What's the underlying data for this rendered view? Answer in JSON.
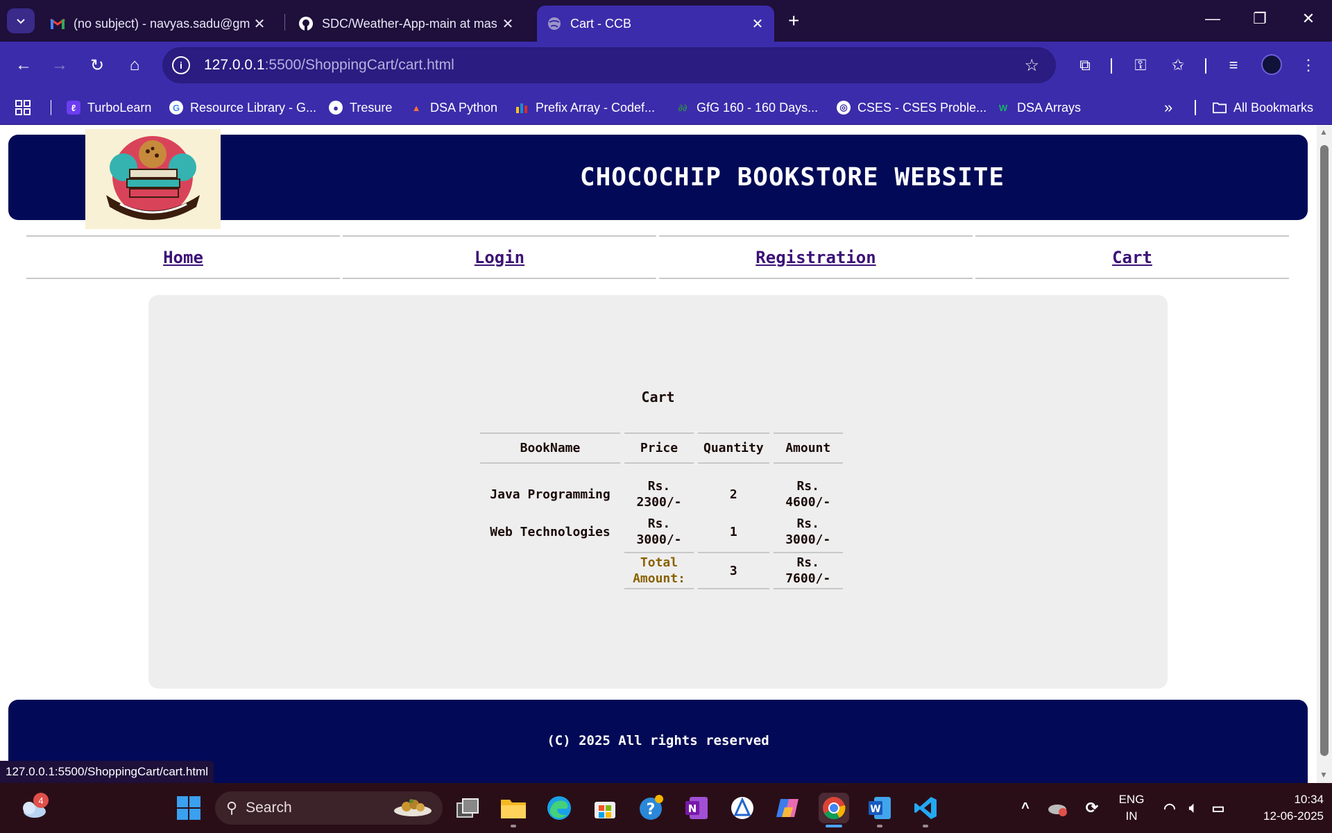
{
  "browser": {
    "tabs": [
      {
        "title": "(no subject) - navyas.sadu@gm",
        "icon": "gmail-icon",
        "active": false
      },
      {
        "title": "SDC/Weather-App-main at mas",
        "icon": "github-icon",
        "active": false
      },
      {
        "title": "Cart - CCB",
        "icon": "globe-icon",
        "active": true
      }
    ],
    "address": {
      "host": "127.0.0.1",
      "path": ":5500/ShoppingCart/cart.html"
    },
    "bookmarks": [
      {
        "label": "TurboLearn",
        "icon": "turbolearn-icon",
        "color": "#6c3df0"
      },
      {
        "label": "Resource Library - G...",
        "icon": "google-icon",
        "color": "#ffffff"
      },
      {
        "label": "Tresure",
        "icon": "github-icon",
        "color": "#ffffff"
      },
      {
        "label": "DSA Python",
        "icon": "dsa-icon",
        "color": "#ffffff"
      },
      {
        "label": "Prefix Array - Codef...",
        "icon": "codeforces-icon",
        "color": "#f5c518"
      },
      {
        "label": "GfG 160 - 160 Days...",
        "icon": "gfg-icon",
        "color": "#2f8d46"
      },
      {
        "label": "CSES - CSES Proble...",
        "icon": "globe-icon",
        "color": "#ffffff"
      },
      {
        "label": "DSA Arrays",
        "icon": "w-icon",
        "color": "#17b26a"
      }
    ],
    "all_bookmarks": "All Bookmarks",
    "status_url": "127.0.0.1:5500/ShoppingCart/cart.html"
  },
  "site": {
    "title": "CHOCOCHIP BOOKSTORE WEBSITE",
    "nav": [
      "Home",
      "Login",
      "Registration",
      "Cart"
    ],
    "cart": {
      "heading": "Cart",
      "columns": [
        "BookName",
        "Price",
        "Quantity",
        "Amount"
      ],
      "rows": [
        {
          "name": "Java Programming",
          "price_1": "Rs.",
          "price_2": "2300/-",
          "qty": "2",
          "amount_1": "Rs.",
          "amount_2": "4600/-"
        },
        {
          "name": "Web Technologies",
          "price_1": "Rs.",
          "price_2": "3000/-",
          "qty": "1",
          "amount_1": "Rs.",
          "amount_2": "3000/-"
        }
      ],
      "total": {
        "label_1": "Total",
        "label_2": "Amount:",
        "qty": "3",
        "amount_1": "Rs.",
        "amount_2": "7600/-"
      }
    },
    "footer": "(C) 2025 All rights reserved",
    "colors": {
      "header_bg": "#020a57",
      "link": "#3c1276",
      "total_label": "#8a6100"
    }
  },
  "taskbar": {
    "search_placeholder": "Search",
    "weather_badge": "4",
    "language_1": "ENG",
    "language_2": "IN",
    "time": "10:34",
    "date": "12-06-2025"
  }
}
